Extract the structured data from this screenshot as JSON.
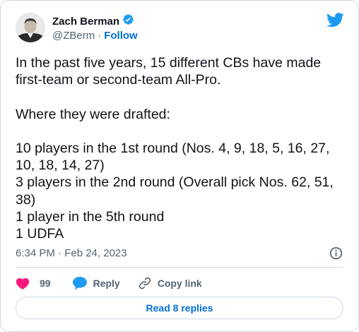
{
  "author": {
    "name": "Zach Berman",
    "handle": "@ZBerm",
    "separator": "·",
    "follow_label": "Follow",
    "verified": true
  },
  "tweet": {
    "text": "In the past five years, 15 different CBs have made first-team or second-team All-Pro.\n\nWhere they were drafted:\n\n10 players in the 1st round (Nos. 4, 9, 18, 5, 16, 27, 10, 18, 14, 27)\n3 players in the 2nd round (Overall pick Nos. 62, 51, 38)\n1 player in the 5th round\n1 UDFA",
    "timestamp": "6:34 PM · Feb 24, 2023"
  },
  "actions": {
    "like_count": "99",
    "reply_label": "Reply",
    "copy_link_label": "Copy link"
  },
  "read_replies_label": "Read 8 replies",
  "icons": {
    "brand": "twitter-bird-icon",
    "verified": "verified-badge-icon",
    "info": "info-icon",
    "like": "heart-icon",
    "reply": "speech-bubble-icon",
    "copy_link": "link-icon"
  },
  "colors": {
    "brand_blue": "#1d9bf0",
    "link_blue": "#006fd6",
    "like_pink": "#f91880",
    "text_primary": "#0f1419",
    "text_secondary": "#536471",
    "border": "#cfd9de"
  }
}
